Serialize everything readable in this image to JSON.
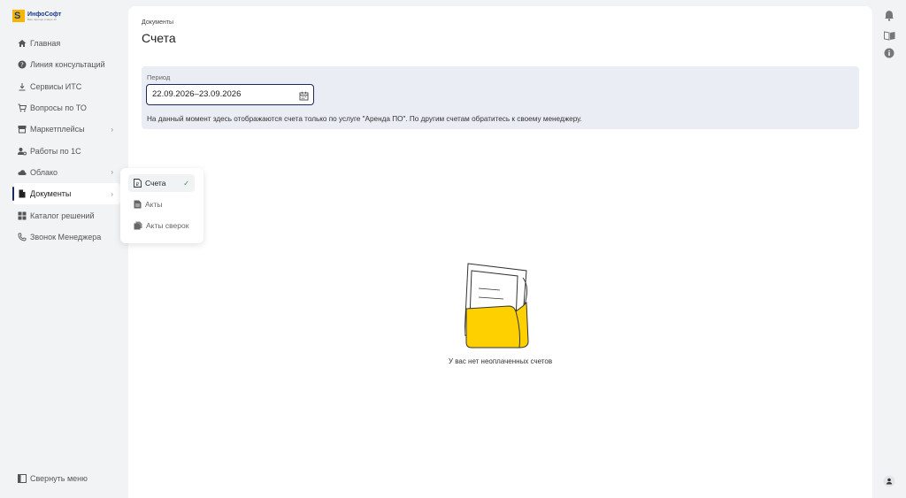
{
  "logo": {
    "brand": "ИнфоСофт",
    "tagline": "Ваш партнер в мире 1С"
  },
  "sidebar": {
    "items": [
      {
        "label": "Главная",
        "icon": "home-icon",
        "chevron": false,
        "active": false
      },
      {
        "label": "Линия консультаций",
        "icon": "help-icon",
        "chevron": false,
        "active": false
      },
      {
        "label": "Сервисы ИТС",
        "icon": "download-icon",
        "chevron": false,
        "active": false
      },
      {
        "label": "Вопросы по ТО",
        "icon": "cart-icon",
        "chevron": false,
        "active": false
      },
      {
        "label": "Маркетплейсы",
        "icon": "store-icon",
        "chevron": true,
        "active": false
      },
      {
        "label": "Работы по 1С",
        "icon": "person-gear-icon",
        "chevron": false,
        "active": false
      },
      {
        "label": "Облако",
        "icon": "cloud-icon",
        "chevron": true,
        "active": false
      },
      {
        "label": "Документы",
        "icon": "document-icon",
        "chevron": true,
        "active": true
      },
      {
        "label": "Каталог решений",
        "icon": "grid-icon",
        "chevron": false,
        "active": false
      },
      {
        "label": "Звонок Менеджера",
        "icon": "phone-icon",
        "chevron": false,
        "active": false
      }
    ],
    "collapse_label": "Свернуть меню"
  },
  "submenu": {
    "items": [
      {
        "label": "Счета",
        "icon": "invoice-icon",
        "selected": true
      },
      {
        "label": "Акты",
        "icon": "act-icon",
        "selected": false
      },
      {
        "label": "Акты сверок",
        "icon": "reconciliation-icon",
        "selected": false
      }
    ]
  },
  "main": {
    "breadcrumb": "Документы",
    "title": "Счета",
    "filter": {
      "period_label": "Период",
      "period_value": "22.09.2026–23.09.2026",
      "note": "На данный момент здесь отображаются счета только по услуге \"Аренда ПО\". По другим счетам обратитесь к своему менеджеру."
    },
    "empty_text": "У вас нет неоплаченных счетов"
  },
  "colors": {
    "accent": "#1d2a5e",
    "folder_yellow": "#ffd000",
    "filter_bg": "#ebedf4"
  }
}
